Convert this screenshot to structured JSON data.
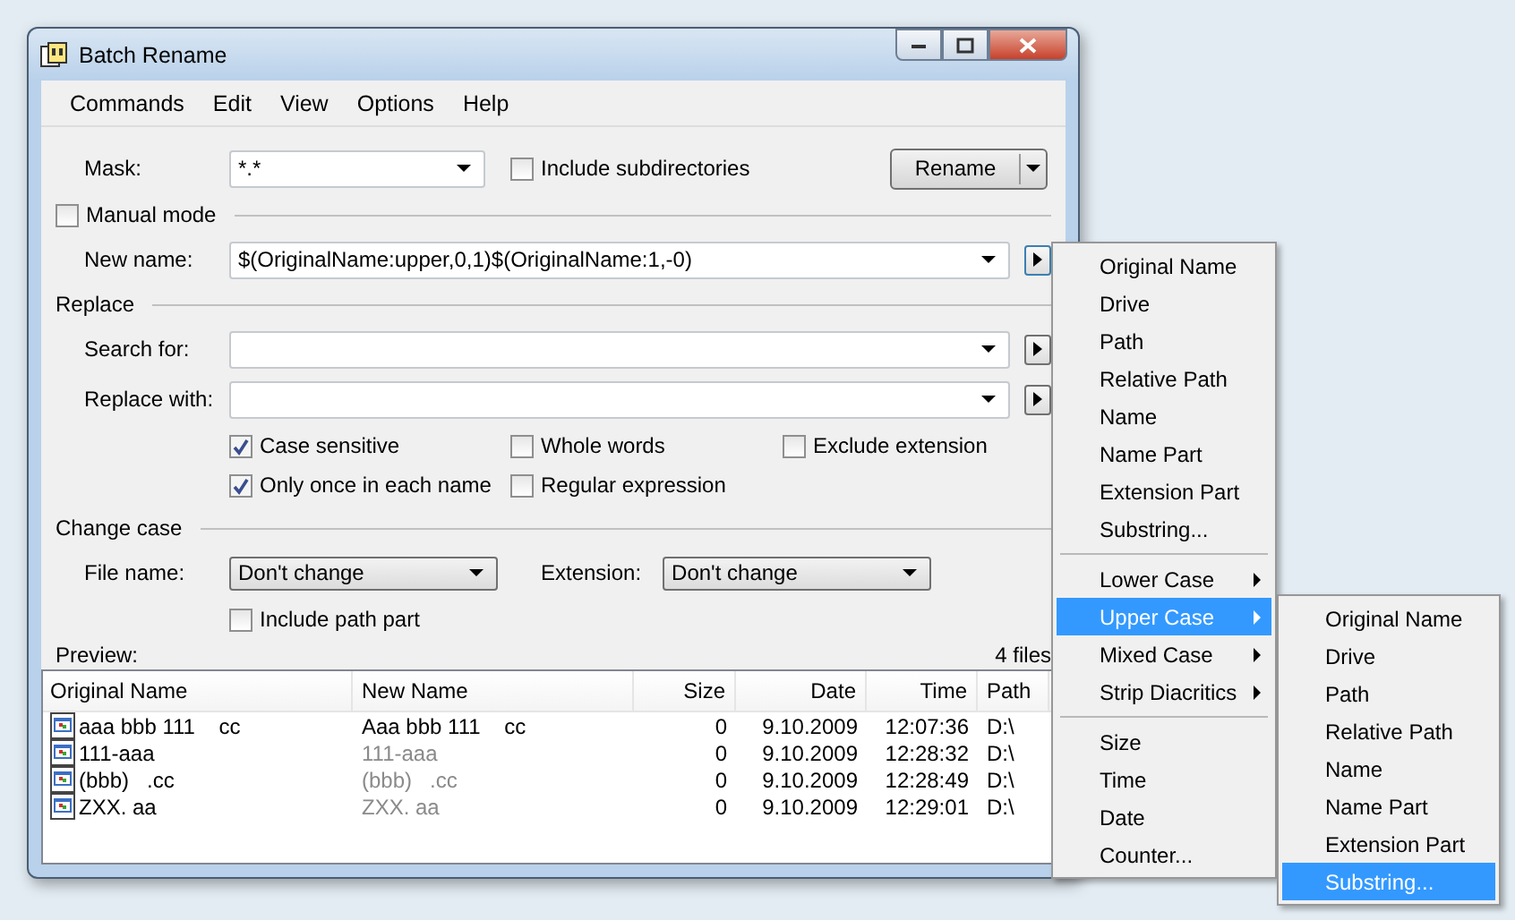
{
  "window": {
    "title": "Batch Rename"
  },
  "menu_bar": [
    "Commands",
    "Edit",
    "View",
    "Options",
    "Help"
  ],
  "mask": {
    "label": "Mask:",
    "value": "*.*"
  },
  "include_subdirectories": {
    "label": "Include subdirectories",
    "checked": false
  },
  "rename_button": "Rename",
  "manual_mode": {
    "label": "Manual mode",
    "checked": false
  },
  "new_name": {
    "label": "New name:",
    "value": "$(OriginalName:upper,0,1)$(OriginalName:1,-0)"
  },
  "replace": {
    "title": "Replace",
    "search_for": {
      "label": "Search for:"
    },
    "replace_with": {
      "label": "Replace with:"
    },
    "options": [
      {
        "label": "Case sensitive",
        "checked": true
      },
      {
        "label": "Whole words",
        "checked": false
      },
      {
        "label": "Exclude extension",
        "checked": false
      },
      {
        "label": "Only once in each name",
        "checked": true
      },
      {
        "label": "Regular expression",
        "checked": false
      }
    ]
  },
  "change_case": {
    "title": "Change case",
    "file_name": {
      "label": "File name:",
      "value": "Don't change"
    },
    "extension": {
      "label": "Extension:",
      "value": "Don't change"
    },
    "include_path_part": {
      "label": "Include path part",
      "checked": false
    }
  },
  "preview": {
    "label": "Preview:",
    "count": "4 files"
  },
  "table": {
    "columns": [
      "Original Name",
      "New Name",
      "Size",
      "Date",
      "Time",
      "Path"
    ],
    "rows": [
      {
        "cells": [
          "aaa bbb 111    cc",
          "Aaa bbb 111    cc",
          "0",
          "9.10.2009",
          "12:07:36",
          "D:\\"
        ],
        "changed": true
      },
      {
        "cells": [
          "111-aaa",
          "111-aaa",
          "0",
          "9.10.2009",
          "12:28:32",
          "D:\\"
        ],
        "changed": false
      },
      {
        "cells": [
          "(bbb)   .cc",
          "(bbb)   .cc",
          "0",
          "9.10.2009",
          "12:28:49",
          "D:\\"
        ],
        "changed": false
      },
      {
        "cells": [
          "ZXX. aa",
          "ZXX. aa",
          "0",
          "9.10.2009",
          "12:29:01",
          "D:\\"
        ],
        "changed": false
      }
    ]
  },
  "popup_menu": [
    {
      "kind": "item",
      "label": "Original Name",
      "selected": false
    },
    {
      "kind": "item",
      "label": "Drive",
      "selected": false
    },
    {
      "kind": "item",
      "label": "Path",
      "selected": false
    },
    {
      "kind": "item",
      "label": "Relative Path",
      "selected": false
    },
    {
      "kind": "item",
      "label": "Name",
      "selected": false
    },
    {
      "kind": "item",
      "label": "Name Part",
      "selected": false
    },
    {
      "kind": "item",
      "label": "Extension Part",
      "selected": false
    },
    {
      "kind": "item",
      "label": "Substring...",
      "selected": false
    },
    {
      "kind": "separator"
    },
    {
      "kind": "submenu",
      "label": "Lower Case",
      "selected": false
    },
    {
      "kind": "submenu",
      "label": "Upper Case",
      "selected": true
    },
    {
      "kind": "submenu",
      "label": "Mixed Case",
      "selected": false
    },
    {
      "kind": "submenu",
      "label": "Strip Diacritics",
      "selected": false
    },
    {
      "kind": "separator"
    },
    {
      "kind": "item",
      "label": "Size",
      "selected": false
    },
    {
      "kind": "item",
      "label": "Time",
      "selected": false
    },
    {
      "kind": "item",
      "label": "Date",
      "selected": false
    },
    {
      "kind": "item",
      "label": "Counter...",
      "selected": false
    }
  ],
  "submenu": [
    {
      "label": "Original Name",
      "selected": false
    },
    {
      "label": "Drive",
      "selected": false
    },
    {
      "label": "Path",
      "selected": false
    },
    {
      "label": "Relative Path",
      "selected": false
    },
    {
      "label": "Name",
      "selected": false
    },
    {
      "label": "Name Part",
      "selected": false
    },
    {
      "label": "Extension Part",
      "selected": false
    },
    {
      "label": "Substring...",
      "selected": true
    }
  ]
}
